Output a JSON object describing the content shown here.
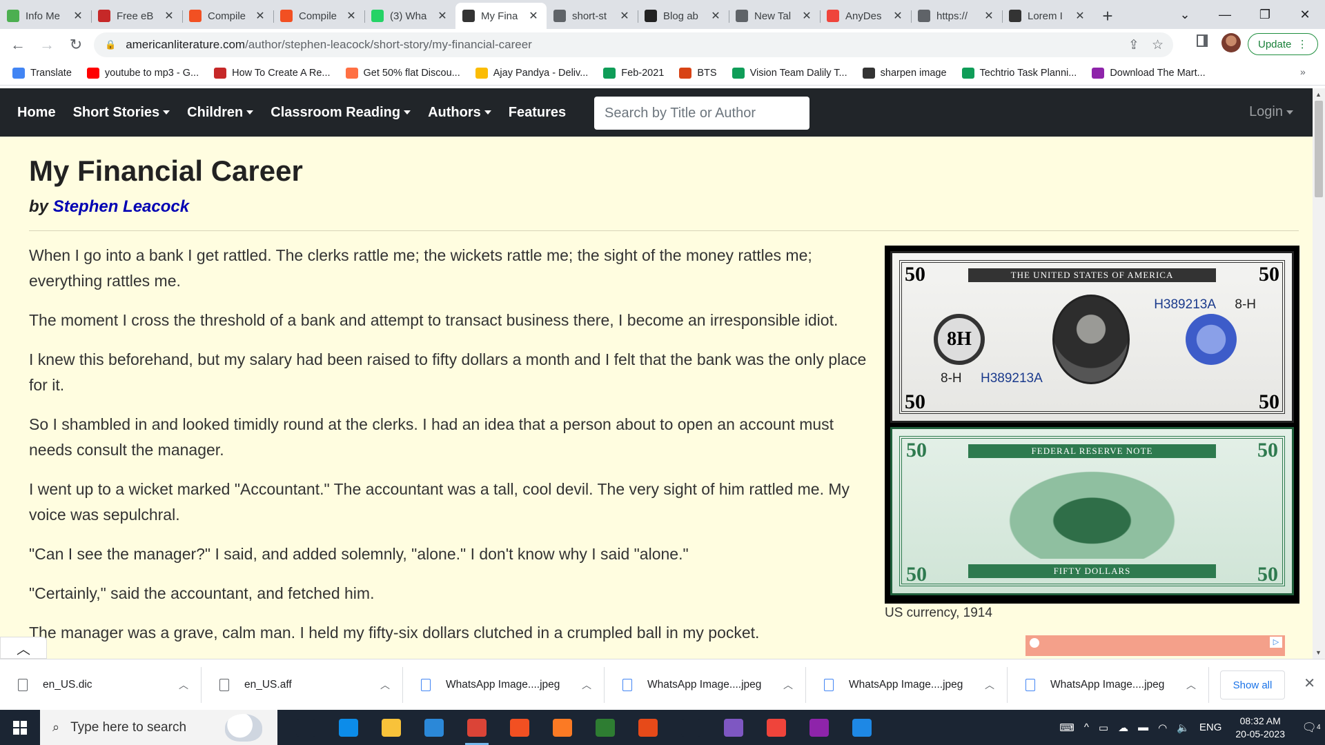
{
  "browser": {
    "tabs": [
      {
        "title": "Info Me",
        "icon": "grid-icon",
        "color": "#4caf50"
      },
      {
        "title": "Free eB",
        "icon": "pg-icon",
        "color": "#c62828"
      },
      {
        "title": "Compile",
        "icon": "microsoft-icon",
        "color": "#f25022"
      },
      {
        "title": "Compile",
        "icon": "microsoft-icon",
        "color": "#f25022"
      },
      {
        "title": "(3) Wha",
        "icon": "whatsapp-icon",
        "color": "#25d366"
      },
      {
        "title": "My Fina",
        "icon": "al-icon",
        "color": "#333333"
      },
      {
        "title": "short-st",
        "icon": "globe-icon",
        "color": "#5f6368"
      },
      {
        "title": "Blog ab",
        "icon": "blog-icon",
        "color": "#222222"
      },
      {
        "title": "New Tal",
        "icon": "chrome-icon",
        "color": "#5f6368"
      },
      {
        "title": "AnyDes",
        "icon": "anydesk-icon",
        "color": "#ef443b"
      },
      {
        "title": "https://",
        "icon": "globe-icon",
        "color": "#5f6368"
      },
      {
        "title": "Lorem I",
        "icon": "lorem-icon",
        "color": "#333333"
      }
    ],
    "active_tab": 5,
    "address": {
      "host": "americanliterature.com",
      "path": "/author/stephen-leacock/short-story/my-financial-career"
    },
    "update_label": "Update",
    "bookmarks": [
      {
        "label": "Translate",
        "color": "#4285f4"
      },
      {
        "label": "youtube to mp3 - G...",
        "color": "#ff0000"
      },
      {
        "label": "How To Create A Re...",
        "color": "#c62828"
      },
      {
        "label": "Get 50% flat Discou...",
        "color": "#ff7043"
      },
      {
        "label": "Ajay Pandya - Deliv...",
        "color": "#fbbc04"
      },
      {
        "label": "Feb-2021",
        "color": "#0f9d58"
      },
      {
        "label": "BTS",
        "color": "#d84315"
      },
      {
        "label": "Vision Team Dalily T...",
        "color": "#0f9d58"
      },
      {
        "label": "sharpen image",
        "color": "#333333"
      },
      {
        "label": "Techtrio Task Planni...",
        "color": "#0f9d58"
      },
      {
        "label": "Download The Mart...",
        "color": "#8e24aa"
      }
    ]
  },
  "site": {
    "nav": [
      {
        "label": "Home",
        "dropdown": false
      },
      {
        "label": "Short Stories",
        "dropdown": true
      },
      {
        "label": "Children",
        "dropdown": true
      },
      {
        "label": "Classroom Reading",
        "dropdown": true
      },
      {
        "label": "Authors",
        "dropdown": true
      },
      {
        "label": "Features",
        "dropdown": false
      }
    ],
    "search_placeholder": "Search by Title or Author",
    "login_label": "Login"
  },
  "article": {
    "title": "My Financial Career",
    "by": "by",
    "author": "Stephen Leacock",
    "paragraphs": [
      "When I go into a bank I get rattled. The clerks rattle me; the wickets rattle me; the sight of the money rattles me; everything rattles me.",
      "The moment I cross the threshold of a bank and attempt to transact business there, I become an irresponsible idiot.",
      "I knew this beforehand, but my salary had been raised to fifty dollars a month and I felt that the bank was the only place for it.",
      "So I shambled in and looked timidly round at the clerks. I had an idea that a person about to open an account must needs consult the manager.",
      "I went up to a wicket marked \"Accountant.\" The accountant was a tall, cool devil. The very sight of him rattled me. My voice was sepulchral.",
      "\"Can I see the manager?\" I said, and added solemnly, \"alone.\" I don't know why I said \"alone.\"",
      "\"Certainly,\" said the accountant, and fetched him.",
      "The manager was a grave, calm man. I held my fifty-six dollars clutched in a crumpled ball in my pocket."
    ],
    "figure": {
      "caption": "US currency, 1914",
      "front": {
        "denomination": "50",
        "banner": "THE UNITED STATES OF AMERICA",
        "serial": "H389213A",
        "district": "8-H",
        "seal_letter": "8H"
      },
      "back": {
        "denomination": "50",
        "banner": "FEDERAL RESERVE NOTE",
        "bottom": "FIFTY DOLLARS"
      }
    }
  },
  "downloads": {
    "files": [
      "en_US.dic",
      "en_US.aff",
      "WhatsApp Image....jpeg",
      "WhatsApp Image....jpeg",
      "WhatsApp Image....jpeg",
      "WhatsApp Image....jpeg"
    ],
    "show_all": "Show all"
  },
  "taskbar": {
    "search_placeholder": "Type here to search",
    "language": "ENG",
    "time": "08:32 AM",
    "date": "20-05-2023",
    "notifications": "4",
    "apps": [
      {
        "name": "task-view-icon",
        "color": "#1b2533"
      },
      {
        "name": "edge-icon",
        "color": "#0c8ce9"
      },
      {
        "name": "file-explorer-icon",
        "color": "#f8c23a"
      },
      {
        "name": "mail-icon",
        "color": "#2b88d8"
      },
      {
        "name": "chrome-icon",
        "color": "#db4437"
      },
      {
        "name": "store-icon",
        "color": "#f25022"
      },
      {
        "name": "xampp-icon",
        "color": "#fb7a24"
      },
      {
        "name": "notepad-icon",
        "color": "#2e7d32"
      },
      {
        "name": "office-icon",
        "color": "#e64a19"
      },
      {
        "name": "settings-icon",
        "color": "#1b2533"
      },
      {
        "name": "visual-studio-icon",
        "color": "#7e57c2"
      },
      {
        "name": "anydesk-icon",
        "color": "#ef443b"
      },
      {
        "name": "winrar-icon",
        "color": "#8e24aa"
      },
      {
        "name": "photos-icon",
        "color": "#1e88e5"
      }
    ]
  }
}
